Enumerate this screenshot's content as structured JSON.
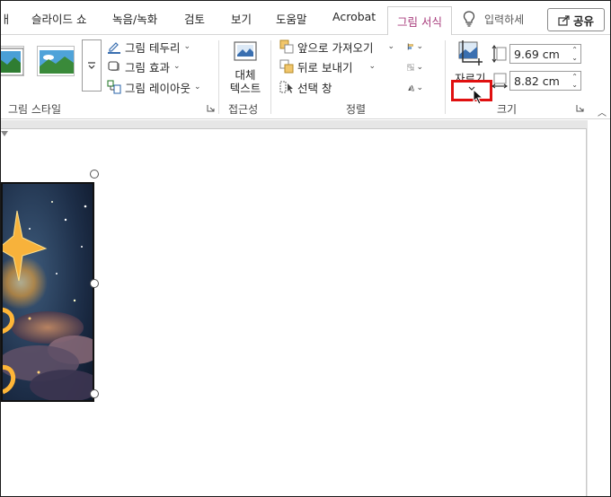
{
  "tabs": {
    "slideshow": "슬라이드 쇼",
    "record": "녹음/녹화",
    "review": "검토",
    "view": "보기",
    "help": "도움말",
    "acrobat": "Acrobat",
    "picture_format": "그림 서식",
    "tell_me": "입력하세",
    "share": "공유"
  },
  "ribbon": {
    "picture_styles": {
      "label": "그림 스타일",
      "border": "그림 테두리",
      "effects": "그림 효과",
      "layout": "그림 레이아웃"
    },
    "accessibility": {
      "label": "접근성",
      "alt_text_line1": "대체",
      "alt_text_line2": "텍스트"
    },
    "arrange": {
      "label": "정렬",
      "bring_forward": "앞으로 가져오기",
      "send_backward": "뒤로 보내기",
      "selection_pane": "선택 창"
    },
    "size": {
      "label": "크기",
      "crop": "자르기",
      "height": "9.69 cm",
      "width": "8.82 cm"
    }
  },
  "colors": {
    "active_tab": "#a83c7c",
    "highlight": "#e01010"
  }
}
